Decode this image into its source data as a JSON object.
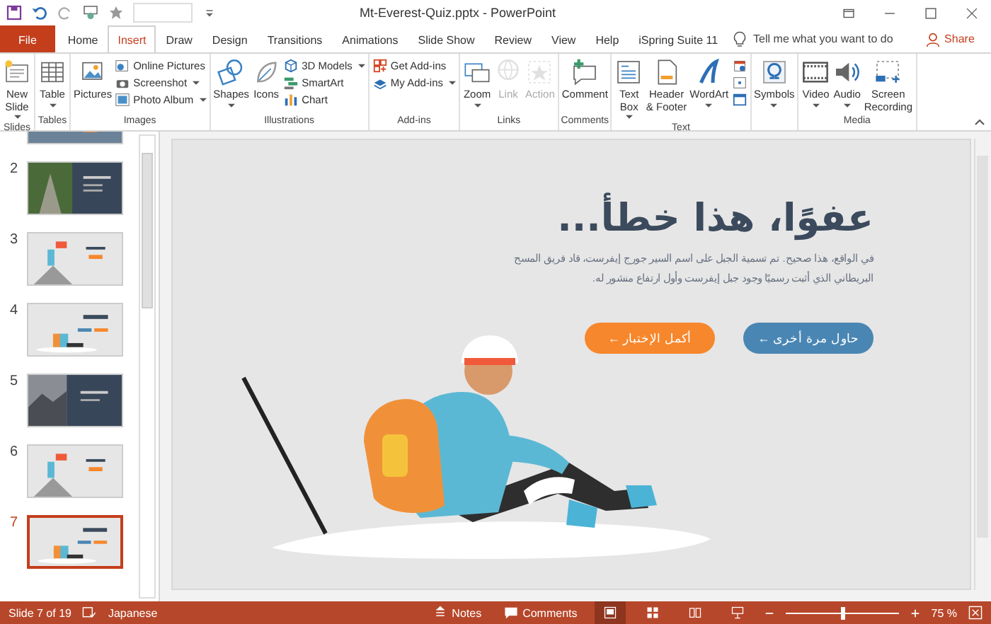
{
  "window": {
    "title": "Mt-Everest-Quiz.pptx  -  PowerPoint"
  },
  "tabs": [
    {
      "label": "File",
      "kind": "file",
      "selected": false
    },
    {
      "label": "Home",
      "kind": "tab",
      "selected": false
    },
    {
      "label": "Insert",
      "kind": "tab",
      "selected": true
    },
    {
      "label": "Draw",
      "kind": "tab",
      "selected": false
    },
    {
      "label": "Design",
      "kind": "tab",
      "selected": false
    },
    {
      "label": "Transitions",
      "kind": "tab",
      "selected": false
    },
    {
      "label": "Animations",
      "kind": "tab",
      "selected": false
    },
    {
      "label": "Slide Show",
      "kind": "tab",
      "selected": false
    },
    {
      "label": "Review",
      "kind": "tab",
      "selected": false
    },
    {
      "label": "View",
      "kind": "tab",
      "selected": false
    },
    {
      "label": "Help",
      "kind": "tab",
      "selected": false
    },
    {
      "label": "iSpring Suite 11",
      "kind": "tab",
      "selected": false
    }
  ],
  "tell_me": {
    "placeholder": "Tell me what you want to do"
  },
  "share": "Share",
  "ribbon": [
    {
      "label": "Slides",
      "items": [
        {
          "label": "New\nSlide",
          "kind": "large",
          "dropdown": true,
          "disabled": false
        }
      ]
    },
    {
      "label": "Tables",
      "items": [
        {
          "label": "Table",
          "kind": "large",
          "dropdown": true,
          "disabled": false
        }
      ]
    },
    {
      "label": "Images",
      "items": [
        {
          "label": "Pictures",
          "kind": "large",
          "dropdown": false,
          "disabled": false
        },
        {
          "label": "Online Pictures",
          "kind": "small",
          "dropdown": false,
          "disabled": false
        },
        {
          "label": "Screenshot",
          "kind": "small",
          "dropdown": true,
          "disabled": false
        },
        {
          "label": "Photo Album",
          "kind": "small",
          "dropdown": true,
          "disabled": false
        }
      ]
    },
    {
      "label": "Illustrations",
      "items": [
        {
          "label": "Shapes",
          "kind": "large",
          "dropdown": true,
          "disabled": false
        },
        {
          "label": "Icons",
          "kind": "large",
          "dropdown": false,
          "disabled": false
        },
        {
          "label": "3D Models",
          "kind": "small",
          "dropdown": true,
          "disabled": false
        },
        {
          "label": "SmartArt",
          "kind": "small",
          "dropdown": false,
          "disabled": false
        },
        {
          "label": "Chart",
          "kind": "small",
          "dropdown": false,
          "disabled": false
        }
      ]
    },
    {
      "label": "Add-ins",
      "items": [
        {
          "label": "Get Add-ins",
          "kind": "small",
          "dropdown": false,
          "disabled": false
        },
        {
          "label": "My Add-ins",
          "kind": "small",
          "dropdown": true,
          "disabled": false
        }
      ]
    },
    {
      "label": "Links",
      "items": [
        {
          "label": "Zoom",
          "kind": "large",
          "dropdown": true,
          "disabled": false
        },
        {
          "label": "Link",
          "kind": "large",
          "dropdown": false,
          "disabled": true
        },
        {
          "label": "Action",
          "kind": "large",
          "dropdown": false,
          "disabled": true
        }
      ]
    },
    {
      "label": "Comments",
      "items": [
        {
          "label": "Comment",
          "kind": "large",
          "dropdown": false,
          "disabled": false
        }
      ]
    },
    {
      "label": "Text",
      "items": [
        {
          "label": "Text\nBox",
          "kind": "large",
          "dropdown": true,
          "disabled": false
        },
        {
          "label": "Header\n& Footer",
          "kind": "large",
          "dropdown": false,
          "disabled": false
        },
        {
          "label": "WordArt",
          "kind": "large",
          "dropdown": true,
          "disabled": false
        },
        {
          "kind": "icon",
          "dropdown": false,
          "disabled": false
        },
        {
          "kind": "icon",
          "dropdown": false,
          "disabled": false
        },
        {
          "kind": "icon",
          "dropdown": false,
          "disabled": false
        }
      ]
    },
    {
      "items": [
        {
          "label": "Symbols",
          "kind": "large",
          "dropdown": true,
          "disabled": false
        }
      ]
    },
    {
      "label": "Media",
      "items": [
        {
          "label": "Video",
          "kind": "large",
          "dropdown": true,
          "disabled": false
        },
        {
          "label": "Audio",
          "kind": "large",
          "dropdown": true,
          "disabled": false
        },
        {
          "label": "Screen\nRecording",
          "kind": "large",
          "dropdown": false,
          "disabled": false
        }
      ]
    }
  ],
  "slides": [
    {
      "kind": "photo-hiker",
      "selected": false
    },
    {
      "number": "2",
      "kind": "photo-bridge",
      "selected": false
    },
    {
      "number": "3",
      "kind": "flag",
      "selected": false
    },
    {
      "number": "4",
      "kind": "sitting",
      "selected": false
    },
    {
      "number": "5",
      "kind": "photo-mountain",
      "selected": false
    },
    {
      "number": "6",
      "kind": "flag",
      "selected": false
    },
    {
      "number": "7",
      "kind": "sitting",
      "selected": true
    }
  ],
  "slide": {
    "title": "عفوًا، هذا خطأ...",
    "body": "في الواقع، هذا صحيح. تم تسمية الجبل على اسم السير جورج إيفرست، قاد فريق المسح البريطاني الذي أثبت رسميًا وجود جبل إيفرست وأول ارتفاع منشور له.",
    "buttons": [
      {
        "label": "حاول مرة أخرى ←",
        "color": "#4a86b3"
      },
      {
        "label": "أكمل الإختبار ←",
        "color": "#f7872c"
      }
    ]
  },
  "status": {
    "slide_info": "Slide 7 of 19",
    "language": "Japanese",
    "notes": "Notes",
    "comments": "Comments",
    "views": [
      {
        "kind": "normal",
        "selected": true
      },
      {
        "kind": "sorter",
        "selected": false
      },
      {
        "kind": "reading",
        "selected": false
      },
      {
        "kind": "slideshow",
        "selected": false
      }
    ],
    "zoom": {
      "level": 0.5,
      "label": "75 %"
    }
  }
}
